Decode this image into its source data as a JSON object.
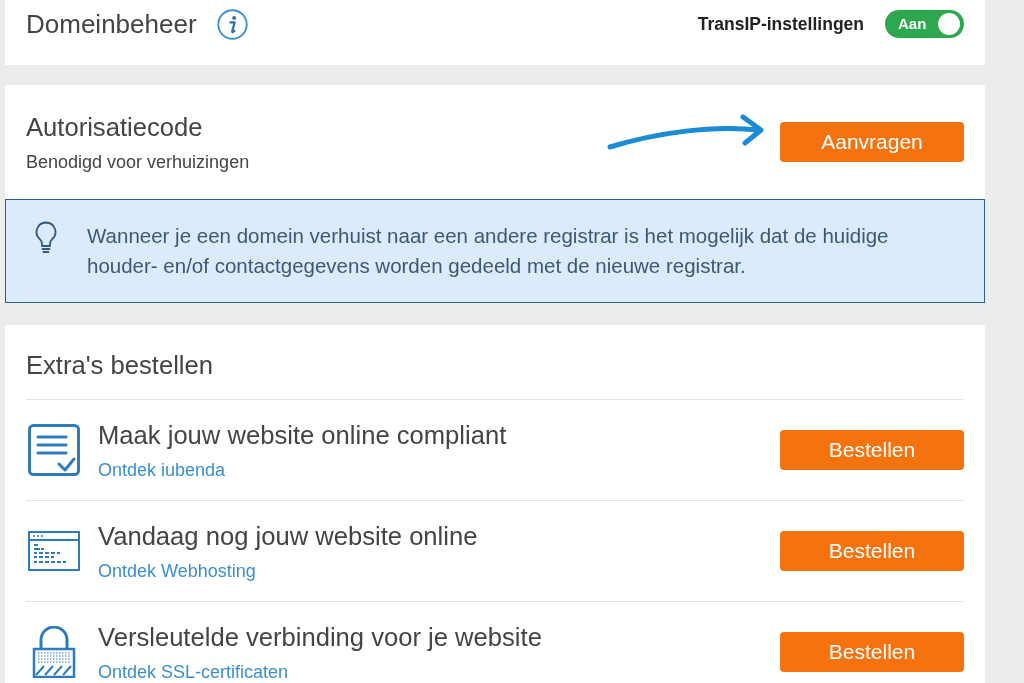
{
  "header": {
    "title": "Domeinbeheer",
    "setting": {
      "label": "TransIP-instellingen",
      "toggle": {
        "on": true,
        "text": "Aan"
      }
    }
  },
  "authorization": {
    "title": "Autorisatiecode",
    "subtitle": "Benodigd voor verhuizingen",
    "button": "Aanvragen"
  },
  "notice": {
    "text": "Wanneer je een domein verhuist naar een andere registrar is het mogelijk dat de huidige houder- en/of contactgegevens worden gedeeld met de nieuwe registrar."
  },
  "extras": {
    "title": "Extra's bestellen",
    "items": [
      {
        "kind": "document",
        "title": "Maak jouw website online compliant",
        "link": "Ontdek iubenda",
        "button": "Bestellen"
      },
      {
        "kind": "browser",
        "title": "Vandaag nog jouw website online",
        "link": "Ontdek Webhosting",
        "button": "Bestellen"
      },
      {
        "kind": "lock",
        "title": "Versleutelde verbinding voor je website",
        "link": "Ontdek SSL-certificaten",
        "button": "Bestellen"
      }
    ]
  }
}
